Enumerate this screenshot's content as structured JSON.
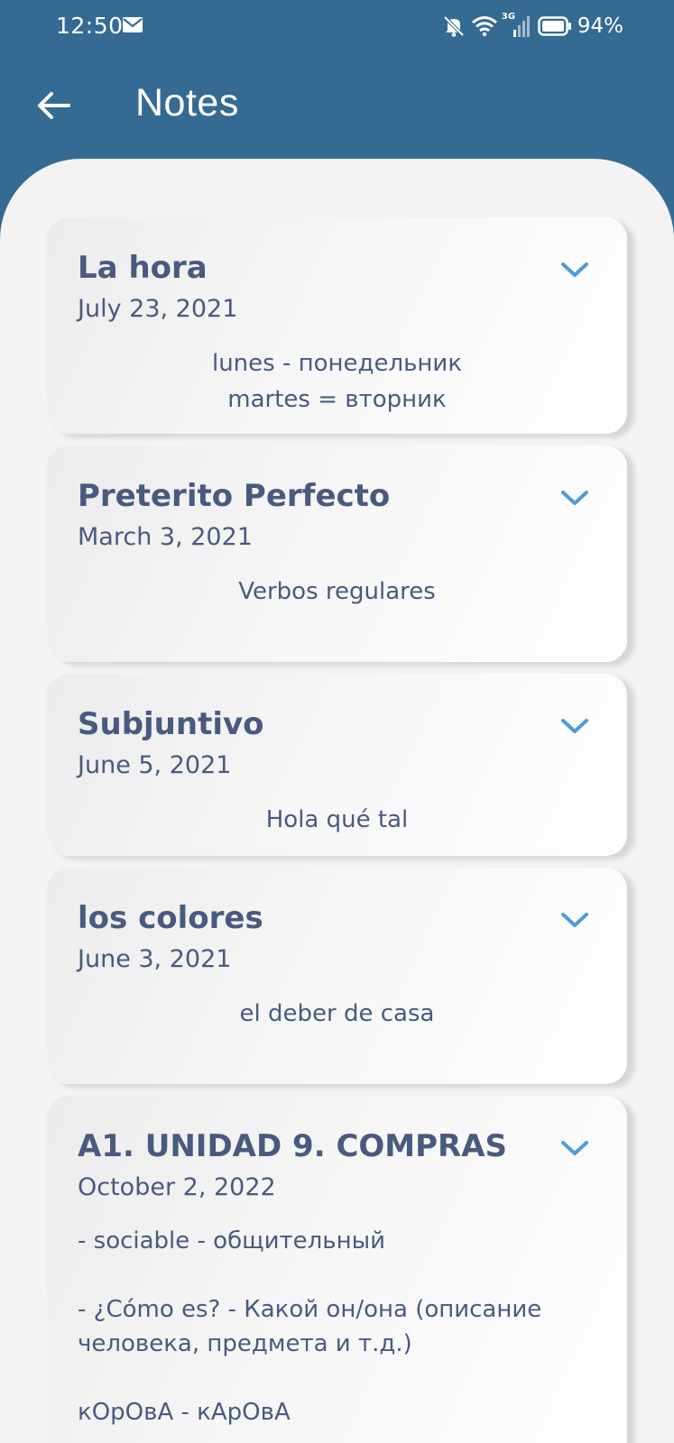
{
  "status_bar": {
    "time": "12:50",
    "network": "3G",
    "battery": "94%"
  },
  "header": {
    "title": "Notes"
  },
  "notes": [
    {
      "title": "La hora",
      "date": "July 23, 2021",
      "body": "lunes - понедельник\nmartes = вторник"
    },
    {
      "title": "Preterito Perfecto",
      "date": "March 3, 2021",
      "body": "Verbos regulares"
    },
    {
      "title": "Subjuntivo",
      "date": "June 5, 2021",
      "body": "Hola qué tal"
    },
    {
      "title": "los colores",
      "date": "June 3, 2021",
      "body": "el deber de casa"
    },
    {
      "title": "A1. UNIDAD 9. COMPRAS",
      "date": "October 2, 2022",
      "body": "- sociable - общительный\n\n- ¿Cómo es? - Какой он/она (описание человека, предмета и т.д.)\n\nкОрОвА - кАрОвА"
    }
  ],
  "colors": {
    "header_bg": "#356b93",
    "panel_bg": "#f3f3f4",
    "text": "#4a5a7e",
    "chevron": "#4f9bd9"
  }
}
